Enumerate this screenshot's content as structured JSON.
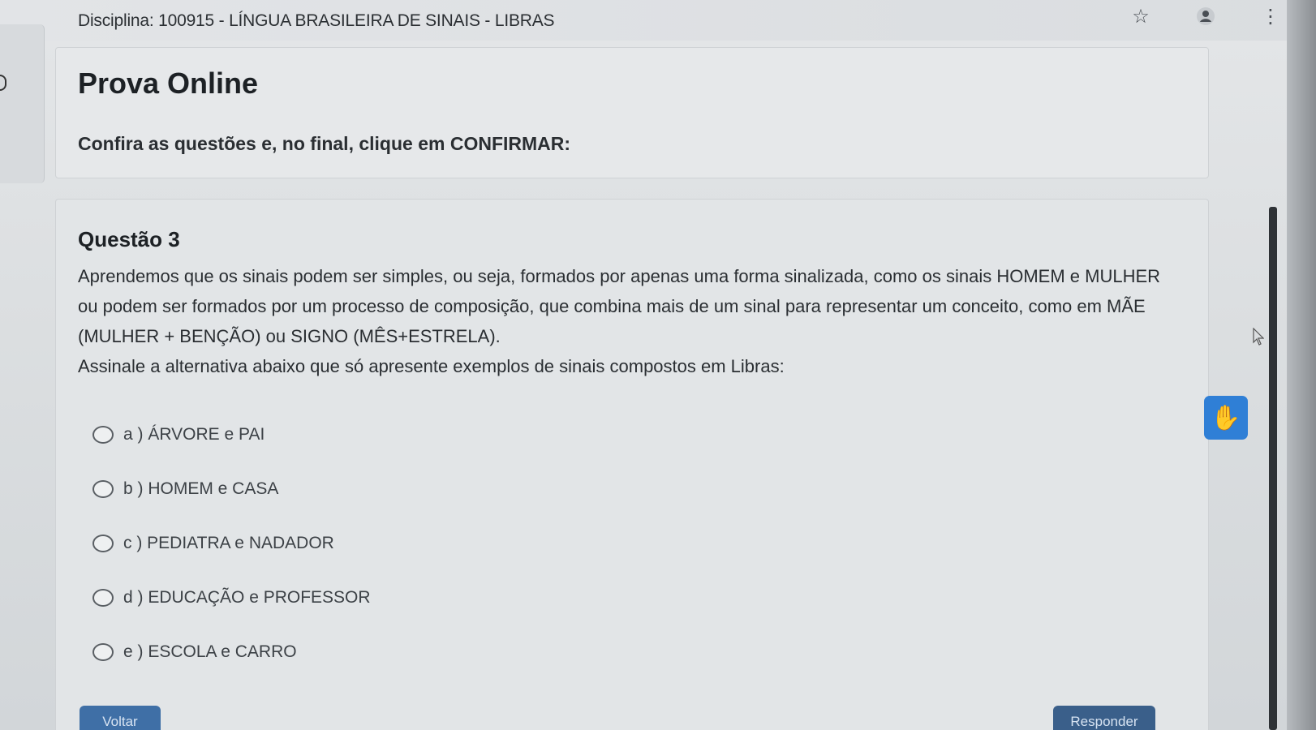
{
  "browser": {
    "icons": [
      "star-icon",
      "profile-icon",
      "more-vert-icon"
    ]
  },
  "header": {
    "discipline": "Disciplina: 100915 - LÍNGUA BRASILEIRA DE SINAIS - LIBRAS",
    "title": "Prova Online",
    "instruction": "Confira as questões e, no final, clique em CONFIRMAR:"
  },
  "question": {
    "title": "Questão 3",
    "statement": "Aprendemos que os sinais podem ser simples, ou seja, formados por apenas uma forma sinalizada, como os sinais HOMEM e MULHER ou podem ser formados por um processo de composição, que combina mais de um sinal para representar um conceito, como em MÃE (MULHER + BENÇÃO) ou SIGNO (MÊS+ESTRELA).",
    "prompt": "Assinale a alternativa abaixo que só apresente exemplos de sinais compostos em Libras:",
    "alternatives": [
      {
        "label": "a ) ÁRVORE e PAI"
      },
      {
        "label": "b ) HOMEM e CASA"
      },
      {
        "label": "c ) PEDIATRA e NADADOR"
      },
      {
        "label": "d ) EDUCAÇÃO e PROFESSOR"
      },
      {
        "label": "e ) ESCOLA e CARRO"
      }
    ]
  },
  "footer": {
    "back_label": "Voltar",
    "answer_label": "Responder"
  },
  "colors": {
    "accent": "#2f7fd6",
    "button": "#3f6fa6"
  }
}
